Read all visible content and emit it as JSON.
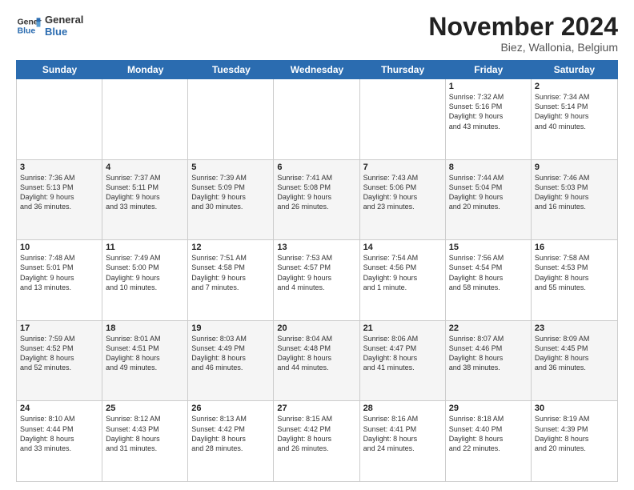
{
  "logo": {
    "line1": "General",
    "line2": "Blue"
  },
  "title": "November 2024",
  "subtitle": "Biez, Wallonia, Belgium",
  "header": {
    "days": [
      "Sunday",
      "Monday",
      "Tuesday",
      "Wednesday",
      "Thursday",
      "Friday",
      "Saturday"
    ]
  },
  "rows": [
    {
      "alt": false,
      "cells": [
        {
          "day": "",
          "info": ""
        },
        {
          "day": "",
          "info": ""
        },
        {
          "day": "",
          "info": ""
        },
        {
          "day": "",
          "info": ""
        },
        {
          "day": "",
          "info": ""
        },
        {
          "day": "1",
          "info": "Sunrise: 7:32 AM\nSunset: 5:16 PM\nDaylight: 9 hours\nand 43 minutes."
        },
        {
          "day": "2",
          "info": "Sunrise: 7:34 AM\nSunset: 5:14 PM\nDaylight: 9 hours\nand 40 minutes."
        }
      ]
    },
    {
      "alt": true,
      "cells": [
        {
          "day": "3",
          "info": "Sunrise: 7:36 AM\nSunset: 5:13 PM\nDaylight: 9 hours\nand 36 minutes."
        },
        {
          "day": "4",
          "info": "Sunrise: 7:37 AM\nSunset: 5:11 PM\nDaylight: 9 hours\nand 33 minutes."
        },
        {
          "day": "5",
          "info": "Sunrise: 7:39 AM\nSunset: 5:09 PM\nDaylight: 9 hours\nand 30 minutes."
        },
        {
          "day": "6",
          "info": "Sunrise: 7:41 AM\nSunset: 5:08 PM\nDaylight: 9 hours\nand 26 minutes."
        },
        {
          "day": "7",
          "info": "Sunrise: 7:43 AM\nSunset: 5:06 PM\nDaylight: 9 hours\nand 23 minutes."
        },
        {
          "day": "8",
          "info": "Sunrise: 7:44 AM\nSunset: 5:04 PM\nDaylight: 9 hours\nand 20 minutes."
        },
        {
          "day": "9",
          "info": "Sunrise: 7:46 AM\nSunset: 5:03 PM\nDaylight: 9 hours\nand 16 minutes."
        }
      ]
    },
    {
      "alt": false,
      "cells": [
        {
          "day": "10",
          "info": "Sunrise: 7:48 AM\nSunset: 5:01 PM\nDaylight: 9 hours\nand 13 minutes."
        },
        {
          "day": "11",
          "info": "Sunrise: 7:49 AM\nSunset: 5:00 PM\nDaylight: 9 hours\nand 10 minutes."
        },
        {
          "day": "12",
          "info": "Sunrise: 7:51 AM\nSunset: 4:58 PM\nDaylight: 9 hours\nand 7 minutes."
        },
        {
          "day": "13",
          "info": "Sunrise: 7:53 AM\nSunset: 4:57 PM\nDaylight: 9 hours\nand 4 minutes."
        },
        {
          "day": "14",
          "info": "Sunrise: 7:54 AM\nSunset: 4:56 PM\nDaylight: 9 hours\nand 1 minute."
        },
        {
          "day": "15",
          "info": "Sunrise: 7:56 AM\nSunset: 4:54 PM\nDaylight: 8 hours\nand 58 minutes."
        },
        {
          "day": "16",
          "info": "Sunrise: 7:58 AM\nSunset: 4:53 PM\nDaylight: 8 hours\nand 55 minutes."
        }
      ]
    },
    {
      "alt": true,
      "cells": [
        {
          "day": "17",
          "info": "Sunrise: 7:59 AM\nSunset: 4:52 PM\nDaylight: 8 hours\nand 52 minutes."
        },
        {
          "day": "18",
          "info": "Sunrise: 8:01 AM\nSunset: 4:51 PM\nDaylight: 8 hours\nand 49 minutes."
        },
        {
          "day": "19",
          "info": "Sunrise: 8:03 AM\nSunset: 4:49 PM\nDaylight: 8 hours\nand 46 minutes."
        },
        {
          "day": "20",
          "info": "Sunrise: 8:04 AM\nSunset: 4:48 PM\nDaylight: 8 hours\nand 44 minutes."
        },
        {
          "day": "21",
          "info": "Sunrise: 8:06 AM\nSunset: 4:47 PM\nDaylight: 8 hours\nand 41 minutes."
        },
        {
          "day": "22",
          "info": "Sunrise: 8:07 AM\nSunset: 4:46 PM\nDaylight: 8 hours\nand 38 minutes."
        },
        {
          "day": "23",
          "info": "Sunrise: 8:09 AM\nSunset: 4:45 PM\nDaylight: 8 hours\nand 36 minutes."
        }
      ]
    },
    {
      "alt": false,
      "cells": [
        {
          "day": "24",
          "info": "Sunrise: 8:10 AM\nSunset: 4:44 PM\nDaylight: 8 hours\nand 33 minutes."
        },
        {
          "day": "25",
          "info": "Sunrise: 8:12 AM\nSunset: 4:43 PM\nDaylight: 8 hours\nand 31 minutes."
        },
        {
          "day": "26",
          "info": "Sunrise: 8:13 AM\nSunset: 4:42 PM\nDaylight: 8 hours\nand 28 minutes."
        },
        {
          "day": "27",
          "info": "Sunrise: 8:15 AM\nSunset: 4:42 PM\nDaylight: 8 hours\nand 26 minutes."
        },
        {
          "day": "28",
          "info": "Sunrise: 8:16 AM\nSunset: 4:41 PM\nDaylight: 8 hours\nand 24 minutes."
        },
        {
          "day": "29",
          "info": "Sunrise: 8:18 AM\nSunset: 4:40 PM\nDaylight: 8 hours\nand 22 minutes."
        },
        {
          "day": "30",
          "info": "Sunrise: 8:19 AM\nSunset: 4:39 PM\nDaylight: 8 hours\nand 20 minutes."
        }
      ]
    }
  ]
}
